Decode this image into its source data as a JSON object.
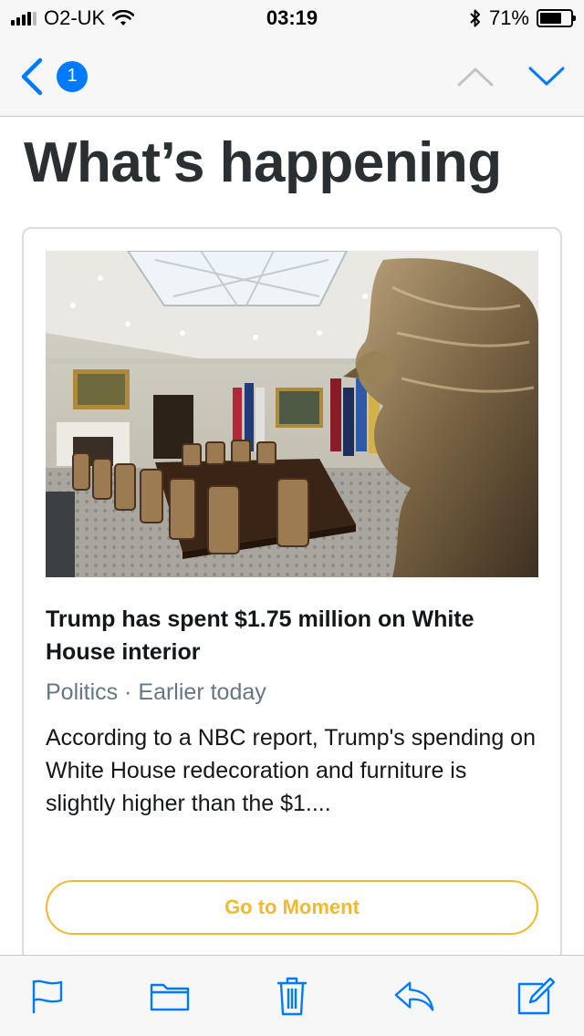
{
  "status_bar": {
    "carrier": "O2-UK",
    "time": "03:19",
    "battery_percent": "71%",
    "battery_level": 0.71,
    "icons": [
      "signal-icon",
      "wifi-icon",
      "bluetooth-icon",
      "battery-icon"
    ]
  },
  "nav": {
    "unread_count": "1",
    "icons": [
      "back-chevron-icon",
      "chevron-up-icon",
      "chevron-down-icon"
    ],
    "accent_color": "#007aff"
  },
  "main": {
    "heading": "What’s happening",
    "card": {
      "headline": "Trump has spent $1.75 million on White House interior",
      "category": "Politics",
      "separator": "·",
      "time": "Earlier today",
      "meta": "Politics · Earlier today",
      "summary": "According to a NBC report, Trump's spending on White House redecoration and furniture is slightly higher than the $1....",
      "button_label": "Go to Moment",
      "button_color": "#f4b82e"
    }
  },
  "toolbar": {
    "icons": [
      "flag-icon",
      "folder-icon",
      "trash-icon",
      "reply-icon",
      "compose-icon"
    ]
  }
}
